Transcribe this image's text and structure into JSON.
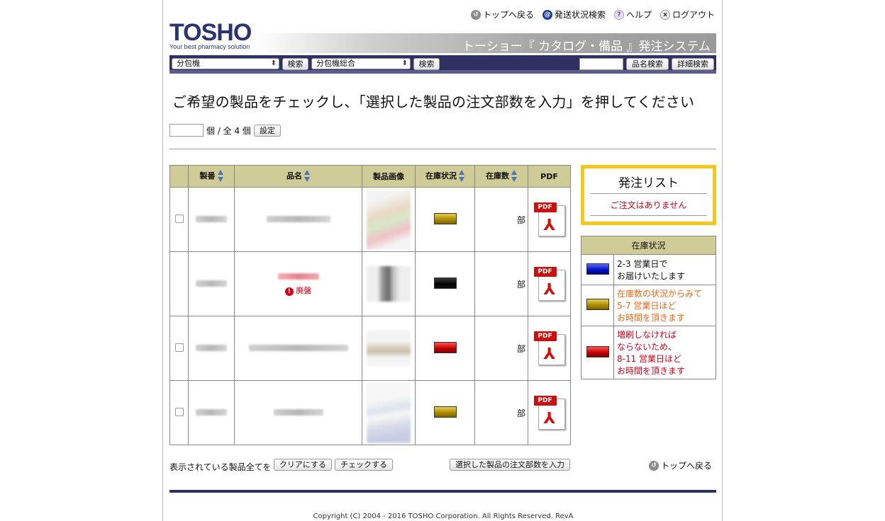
{
  "top_links": {
    "back_to_top": "トップへ戻る",
    "shipping_search": "発送状況検索",
    "help": "ヘルプ",
    "logout": "ログアウト"
  },
  "logo": {
    "name": "TOSHO",
    "tagline": "Your best pharmacy solution"
  },
  "banner_title": "トーショー『 カタログ・備品 』発注システム",
  "search": {
    "category_select": "分包機",
    "category_search_button": "検索",
    "subcategory_select": "分包機総合",
    "subcategory_search_button": "検索",
    "keyword_value": "",
    "name_search_button": "品名検索",
    "detail_search_button": "詳細検索"
  },
  "headline": "ご希望の製品をチェックし、「選択した製品の注文部数を入力」を押してください",
  "quantity_row": {
    "suffix": "個 / 全 4 個",
    "set_button": "設定"
  },
  "table": {
    "headers": [
      "製番",
      "品名",
      "製品画像",
      "在庫状況",
      "在庫数",
      "PDF"
    ],
    "unit": "部",
    "pdf_label": "PDF",
    "discontinued_label": "廃盤",
    "rows": [
      {
        "stock": "gold",
        "discontinued": false,
        "has_checkbox": true
      },
      {
        "stock": "black",
        "discontinued": true,
        "has_checkbox": false
      },
      {
        "stock": "red",
        "discontinued": false,
        "has_checkbox": true
      },
      {
        "stock": "gold",
        "discontinued": false,
        "has_checkbox": true
      }
    ]
  },
  "order_list": {
    "title": "発注リスト",
    "empty_message": "ご注文はありません"
  },
  "legend": {
    "title": "在庫状況",
    "items": [
      {
        "color": "blue",
        "line1": "2-3 営業日で",
        "line2": "お届けいたします",
        "line3": "",
        "line4": ""
      },
      {
        "color": "gold",
        "line1": "在庫数の状況からみて",
        "line2": "5-7 営業日ほど",
        "line3": "お時間を頂きます",
        "line4": ""
      },
      {
        "color": "red",
        "line1": "増刷しなければ",
        "line2": "ならないため、",
        "line3": "8-11 営業日ほど",
        "line4": "お時間を頂きます"
      }
    ]
  },
  "bottom": {
    "all_label": "表示されている製品全てを",
    "clear_button": "クリアにする",
    "check_button": "チェックする",
    "enter_button": "選択した製品の注文部数を入力",
    "back_to_top": "トップへ戻る"
  },
  "copyright": "Copyright (C) 2004 - 2016 TOSHO Corporation. All Rights Reserved. RevA"
}
